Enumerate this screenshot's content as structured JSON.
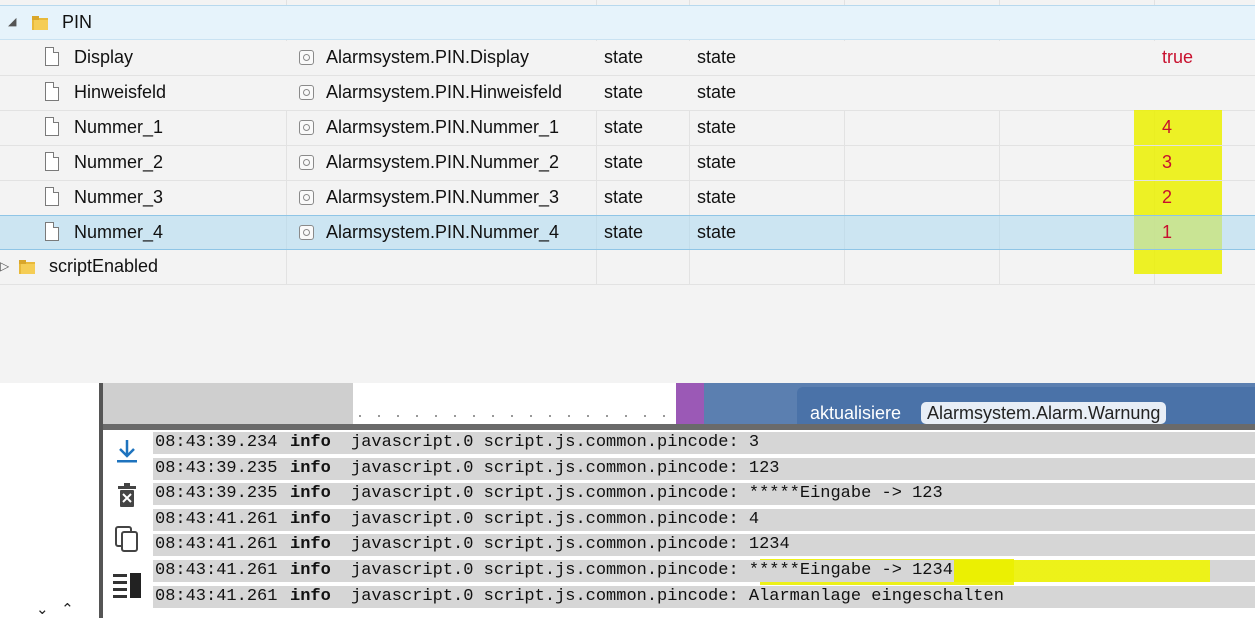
{
  "tree": {
    "folder": {
      "name": "PIN"
    },
    "rows": [
      {
        "name": "Display",
        "id": "Alarmsystem.PIN.Display",
        "type": "state",
        "role": "state",
        "value": "true"
      },
      {
        "name": "Hinweisfeld",
        "id": "Alarmsystem.PIN.Hinweisfeld",
        "type": "state",
        "role": "state",
        "value": ""
      },
      {
        "name": "Nummer_1",
        "id": "Alarmsystem.PIN.Nummer_1",
        "type": "state",
        "role": "state",
        "value": "4"
      },
      {
        "name": "Nummer_2",
        "id": "Alarmsystem.PIN.Nummer_2",
        "type": "state",
        "role": "state",
        "value": "3"
      },
      {
        "name": "Nummer_3",
        "id": "Alarmsystem.PIN.Nummer_3",
        "type": "state",
        "role": "state",
        "value": "2"
      },
      {
        "name": "Nummer_4",
        "id": "Alarmsystem.PIN.Nummer_4",
        "type": "state",
        "role": "state",
        "value": "1"
      }
    ],
    "folder2": {
      "name": "scriptEnabled"
    }
  },
  "editor": {
    "block_label": "aktualisiere",
    "block_chip": "Alarmsystem.Alarm.Warnung"
  },
  "log": {
    "toolbar_icons": [
      "download-icon",
      "trash-icon",
      "copy-icon",
      "columns-icon"
    ],
    "entries": [
      {
        "time": "08:43:39.234",
        "level": "info",
        "source": "javascript.0",
        "message": "script.js.common.pincode: 3"
      },
      {
        "time": "08:43:39.235",
        "level": "info",
        "source": "javascript.0",
        "message": "script.js.common.pincode: 123"
      },
      {
        "time": "08:43:39.235",
        "level": "info",
        "source": "javascript.0",
        "message": "script.js.common.pincode: *****Eingabe -> 123"
      },
      {
        "time": "08:43:41.261",
        "level": "info",
        "source": "javascript.0",
        "message": "script.js.common.pincode: 4"
      },
      {
        "time": "08:43:41.261",
        "level": "info",
        "source": "javascript.0",
        "message": "script.js.common.pincode: 1234"
      },
      {
        "time": "08:43:41.261",
        "level": "info",
        "source": "javascript.0",
        "message": "script.js.common.pincode: *****Eingabe -> 1234"
      },
      {
        "time": "08:43:41.261",
        "level": "info",
        "source": "javascript.0",
        "message": "script.js.common.pincode: Alarmanlage eingeschalten"
      }
    ]
  },
  "colors": {
    "value_red": "#c8102e",
    "highlight_yellow": "#ebf000",
    "selection_blue": "#cde8f7"
  }
}
